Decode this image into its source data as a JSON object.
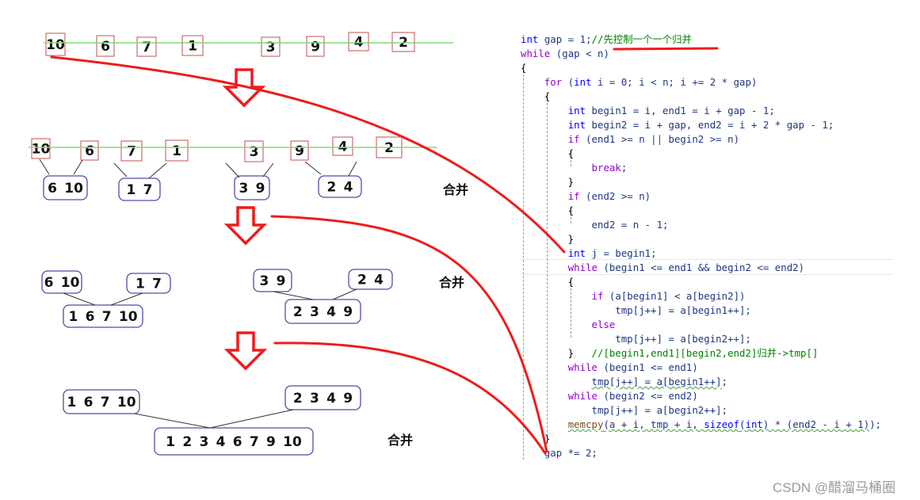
{
  "diagram": {
    "row1": [
      "10",
      "6",
      "7",
      "1",
      "3",
      "9",
      "4",
      "2"
    ],
    "row2_singles": [
      "10",
      "6",
      "7",
      "1",
      "3",
      "9",
      "4",
      "2"
    ],
    "row2_merged": [
      "6 10",
      "1 7",
      "3 9",
      "2 4"
    ],
    "row3_pairs": [
      "6 10",
      "1 7",
      "3 9",
      "2 4"
    ],
    "row3_merged": [
      "1 6 7 10",
      "2 3 4 9"
    ],
    "row4_inputs": [
      "1 6 7 10",
      "2 3 4 9"
    ],
    "row4_merged": "1 2 3 4 6 7 9 10",
    "merge_label": "合并",
    "colors": {
      "single_box": "#c0504d",
      "merged_box": "#4b4fa8",
      "baseline": "#7fdc7f",
      "annotation": "#ee1c1c"
    }
  },
  "code": [
    [
      [
        "int",
        "kw"
      ],
      [
        " gap = 1;",
        "tx"
      ],
      [
        "//先控制一个一个归并",
        "cm"
      ]
    ],
    [
      [
        "while",
        "ctl"
      ],
      [
        " (gap < n)",
        "tx"
      ]
    ],
    [
      [
        "{",
        "op"
      ]
    ],
    [
      [
        "    ",
        "tx"
      ],
      [
        "for",
        "ctl"
      ],
      [
        " (",
        "tx"
      ],
      [
        "int",
        "kw"
      ],
      [
        " i = 0; i < n; i += 2 * gap)",
        "tx"
      ]
    ],
    [
      [
        "    {",
        "op"
      ]
    ],
    [
      [
        "        ",
        "tx"
      ],
      [
        "int",
        "kw"
      ],
      [
        " begin1 = i, end1 = i + gap - 1;",
        "tx"
      ]
    ],
    [
      [
        "        ",
        "tx"
      ],
      [
        "int",
        "kw"
      ],
      [
        " begin2 = i + gap, end2 = i + 2 * gap - 1;",
        "tx"
      ]
    ],
    [
      [
        "        ",
        "tx"
      ],
      [
        "if",
        "ctl"
      ],
      [
        " (end1 >= n || begin2 >= n)",
        "tx"
      ]
    ],
    [
      [
        "        {",
        "op"
      ]
    ],
    [
      [
        "            ",
        "tx"
      ],
      [
        "break",
        "ctl"
      ],
      [
        ";",
        "tx"
      ]
    ],
    [
      [
        "        }",
        "op"
      ]
    ],
    [
      [
        "        ",
        "tx"
      ],
      [
        "if",
        "ctl"
      ],
      [
        " (end2 >= n)",
        "tx"
      ]
    ],
    [
      [
        "        {",
        "op"
      ]
    ],
    [
      [
        "            end2 = n - 1;",
        "tx"
      ]
    ],
    [
      [
        "        }",
        "op"
      ]
    ],
    [
      [
        "        ",
        "tx"
      ],
      [
        "int",
        "kw"
      ],
      [
        " j = begin1;",
        "tx"
      ]
    ],
    [
      [
        "        ",
        "tx"
      ],
      [
        "while",
        "ctl"
      ],
      [
        " (begin1 <= end1 && begin2 <= end2)",
        "tx"
      ]
    ],
    [
      [
        "        {",
        "op"
      ]
    ],
    [
      [
        "            ",
        "tx"
      ],
      [
        "if",
        "ctl"
      ],
      [
        " (a[begin1] < a[begin2])",
        "tx"
      ]
    ],
    [
      [
        "                tmp[j++] = a[begin1++];",
        "tx"
      ]
    ],
    [
      [
        "            ",
        "tx"
      ],
      [
        "else",
        "ctl"
      ]
    ],
    [
      [
        "                tmp[j++] = a[begin2++];",
        "tx"
      ]
    ],
    [
      [
        "        }   ",
        "op"
      ],
      [
        "//[begin1,end1][begin2,end2]归并->tmp[]",
        "cm"
      ]
    ],
    [
      [
        "        ",
        "tx"
      ],
      [
        "while",
        "ctl"
      ],
      [
        " (begin1 <= end1)",
        "tx"
      ]
    ],
    [
      [
        "            ",
        "tx"
      ],
      [
        "tmp[j++] = a[begin1++]",
        "tx squig"
      ],
      [
        ";",
        "tx"
      ]
    ],
    [
      [
        "        ",
        "tx"
      ],
      [
        "while",
        "ctl"
      ],
      [
        " (begin2 <= end2)",
        "tx"
      ]
    ],
    [
      [
        "            tmp[j++] = a[begin2++];",
        "tx"
      ]
    ],
    [
      [
        "        ",
        "tx"
      ],
      [
        "memcpy",
        "fn squig"
      ],
      [
        "(a + i, tmp + i, ",
        "tx squig"
      ],
      [
        "sizeof",
        "kw squig"
      ],
      [
        "(",
        "tx squig"
      ],
      [
        "int",
        "kw squig"
      ],
      [
        ") * (end2 - i + 1)",
        "tx squig"
      ],
      [
        ");",
        "tx"
      ]
    ],
    [
      [
        "    }",
        "op"
      ]
    ],
    [
      [
        "    gap *= 2;",
        "tx"
      ]
    ]
  ],
  "watermark": "CSDN @醋溜马桶圈"
}
